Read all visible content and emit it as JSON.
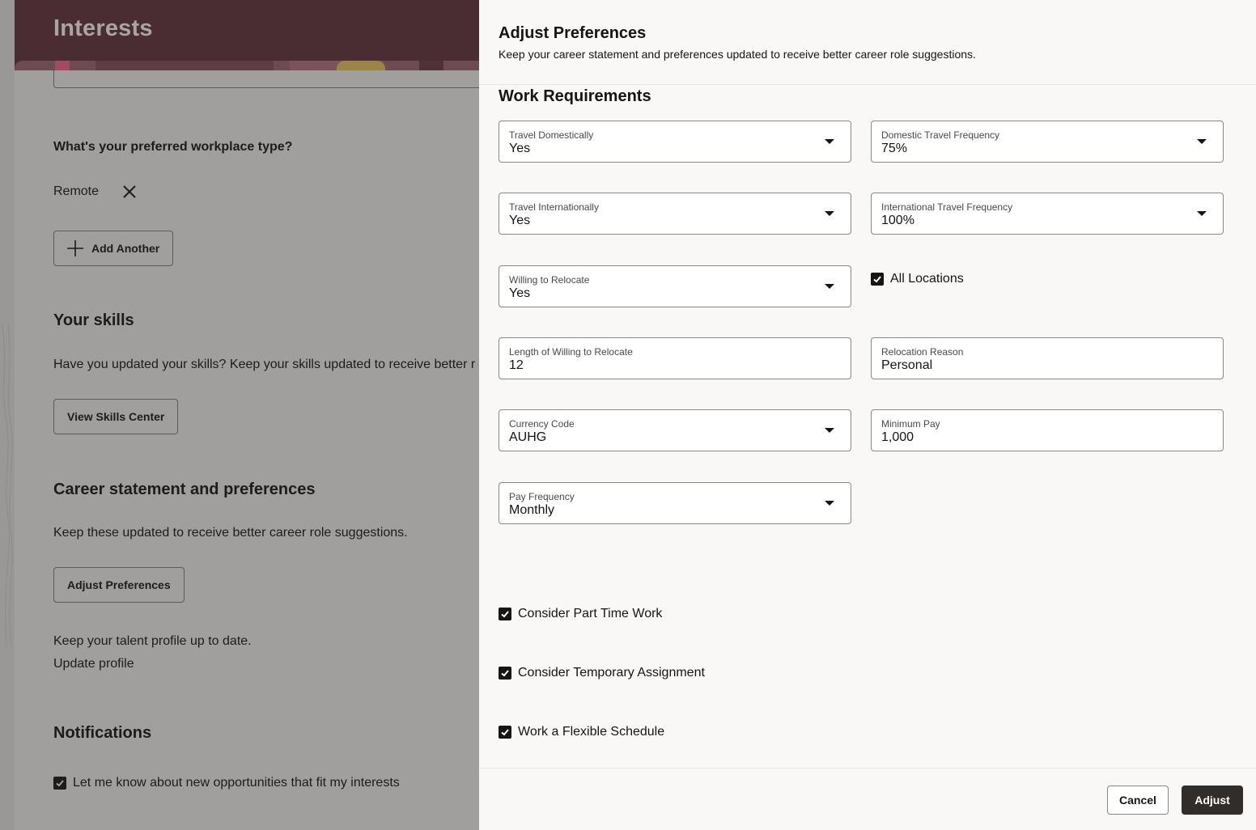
{
  "background_page": {
    "title": "Interests",
    "workplace_question": "What's your preferred workplace type?",
    "workplace_selected": "Remote",
    "add_another_label": "Add Another",
    "skills_heading": "Your skills",
    "skills_text": "Have you updated your skills? Keep your skills updated to receive better r",
    "view_skills_label": "View Skills Center",
    "career_heading": "Career statement and preferences",
    "career_text": "Keep these updated to receive better career role suggestions.",
    "adjust_preferences_label": "Adjust Preferences",
    "profile_text": "Keep your talent profile up to date.",
    "update_profile_link": "Update profile",
    "notifications_heading": "Notifications",
    "notify_checkbox_label": "Let me know about new opportunities that fit my interests",
    "notify_checked": true
  },
  "drawer": {
    "title": "Adjust Preferences",
    "subtitle": "Keep your career statement and preferences updated to receive better career role suggestions.",
    "section_title": "Work Requirements",
    "fields": {
      "travel_domestically": {
        "label": "Travel Domestically",
        "value": "Yes",
        "type": "select"
      },
      "domestic_travel_frequency": {
        "label": "Domestic Travel Frequency",
        "value": "75%",
        "type": "select"
      },
      "travel_internationally": {
        "label": "Travel Internationally",
        "value": "Yes",
        "type": "select"
      },
      "international_travel_frequency": {
        "label": "International Travel Frequency",
        "value": "100%",
        "type": "select"
      },
      "willing_to_relocate": {
        "label": "Willing to Relocate",
        "value": "Yes",
        "type": "select"
      },
      "length_willing_to_relocate": {
        "label": "Length of Willing to Relocate",
        "value": "12",
        "type": "text"
      },
      "relocation_reason": {
        "label": "Relocation Reason",
        "value": "Personal",
        "type": "text"
      },
      "currency_code": {
        "label": "Currency Code",
        "value": "AUHG",
        "type": "select"
      },
      "minimum_pay": {
        "label": "Minimum Pay",
        "value": "1,000",
        "type": "text"
      },
      "pay_frequency": {
        "label": "Pay Frequency",
        "value": "Monthly",
        "type": "select"
      }
    },
    "checkboxes": {
      "all_locations": {
        "label": "All Locations",
        "checked": true
      },
      "part_time": {
        "label": "Consider Part Time Work",
        "checked": true
      },
      "temporary": {
        "label": "Consider Temporary Assignment",
        "checked": true
      },
      "flexible": {
        "label": "Work a Flexible Schedule",
        "checked": true
      }
    },
    "footer": {
      "cancel_label": "Cancel",
      "adjust_label": "Adjust"
    }
  },
  "colors": {
    "banner": "#4a2d33",
    "overlay_gray": "#a09f9d",
    "primary_button": "#312d2a",
    "link": "#0e4f6a"
  }
}
